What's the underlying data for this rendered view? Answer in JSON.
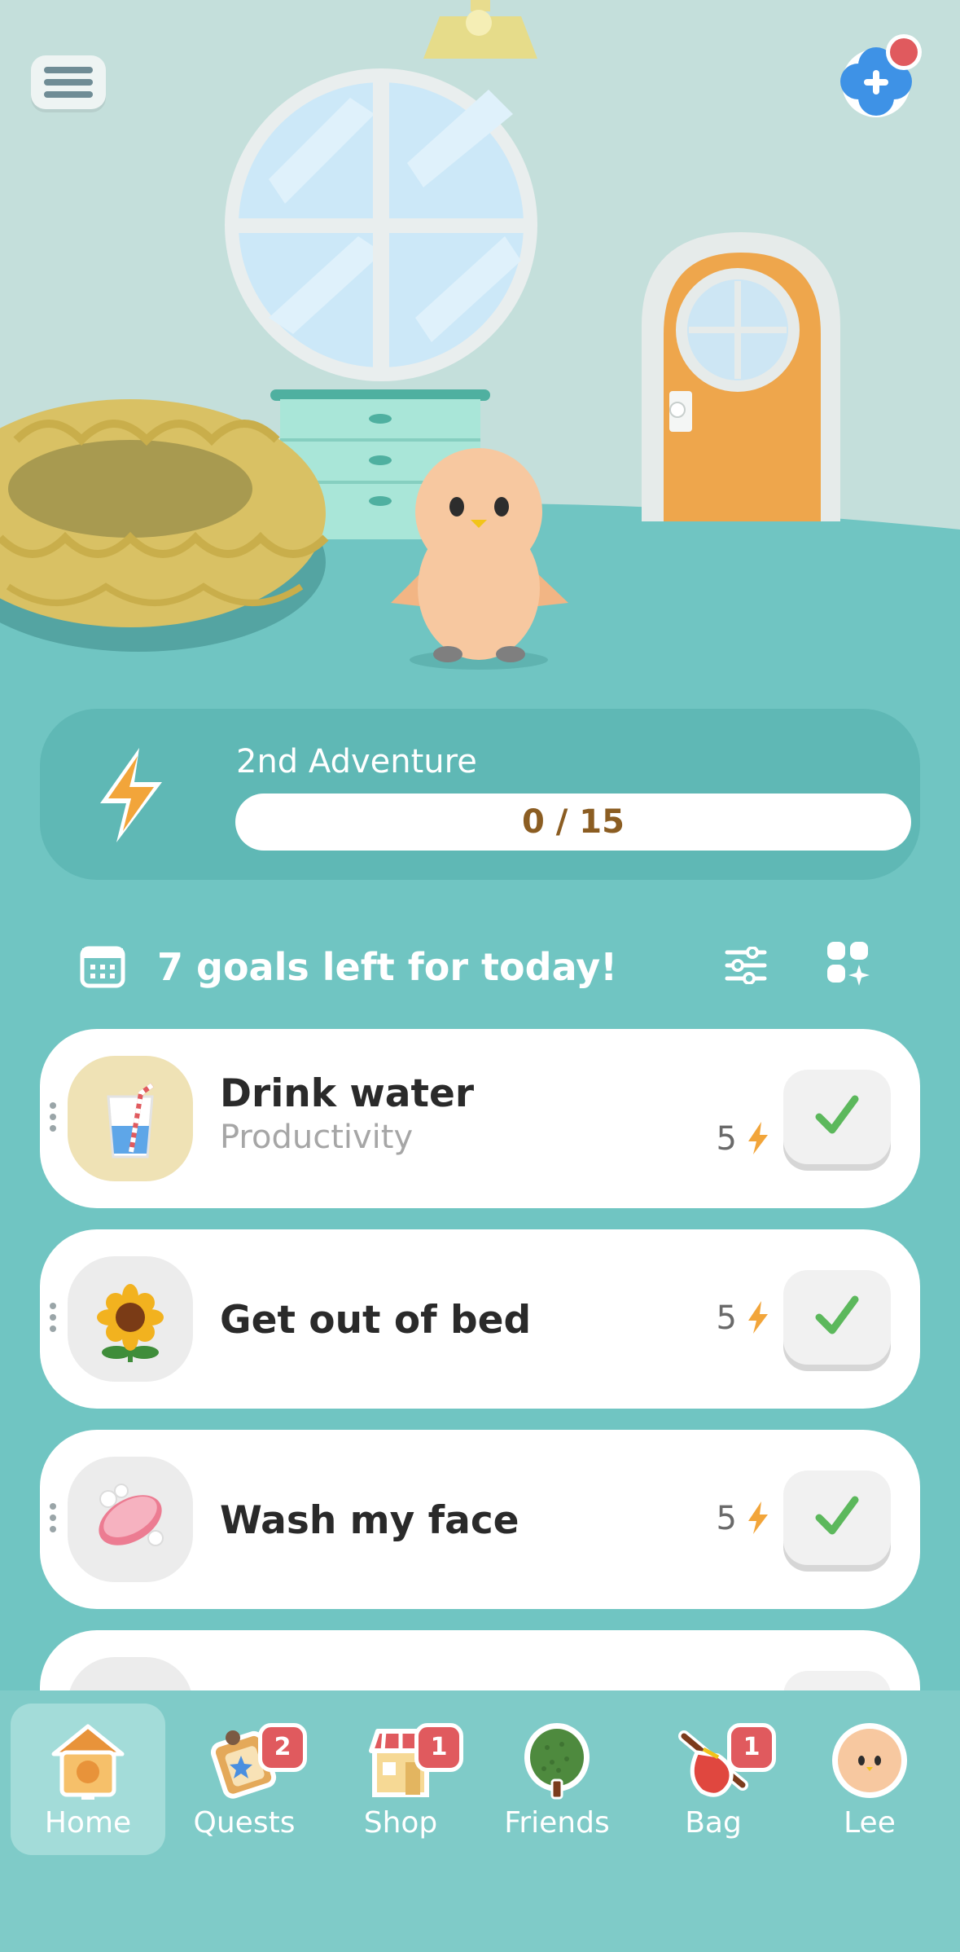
{
  "adventure": {
    "title": "2nd Adventure",
    "progress_text": "0 / 15",
    "progress": 0
  },
  "goals": {
    "header": "7 goals left for today!",
    "items": [
      {
        "name": "Drink water",
        "category": "Productivity",
        "points": "5",
        "icon": "water-glass-icon"
      },
      {
        "name": "Get out of bed",
        "category": "",
        "points": "5",
        "icon": "sunflower-icon"
      },
      {
        "name": "Wash my face",
        "category": "",
        "points": "5",
        "icon": "soap-icon"
      }
    ]
  },
  "nav": {
    "home": "Home",
    "quests": "Quests",
    "quests_badge": "2",
    "shop": "Shop",
    "shop_badge": "1",
    "friends": "Friends",
    "bag": "Bag",
    "bag_badge": "1",
    "profile": "Lee"
  },
  "colors": {
    "background": "#70c5c2",
    "wall": "#c4dfdb",
    "accent_orange": "#f2a53a",
    "check_green": "#5cb85c",
    "badge_red": "#e05a5e"
  }
}
